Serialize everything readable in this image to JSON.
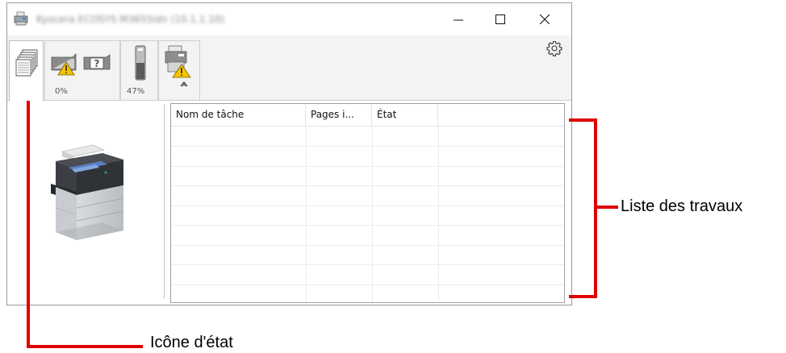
{
  "window": {
    "title": "Kyocera ECOSYS M3655idn (10.1.1.10)",
    "controls": {
      "minimize": "–",
      "maximize": "□",
      "close": "×"
    }
  },
  "status_tabs": {
    "consumables_percent": "0%",
    "toner_percent": "47%"
  },
  "job_list": {
    "columns": [
      "Nom de tâche",
      "Pages i...",
      "État"
    ],
    "rows": []
  },
  "callouts": {
    "job_list_label": "Liste des travaux",
    "status_icon_label": "Icône d'état"
  },
  "colors": {
    "callout_red": "#e00000",
    "warning_yellow": "#f5c400"
  },
  "icons": [
    "printer-app-icon",
    "document-stack-icon",
    "warning-icon",
    "help-icon",
    "toner-icon",
    "device-warning-icon",
    "collapse-icon",
    "gear-icon"
  ]
}
